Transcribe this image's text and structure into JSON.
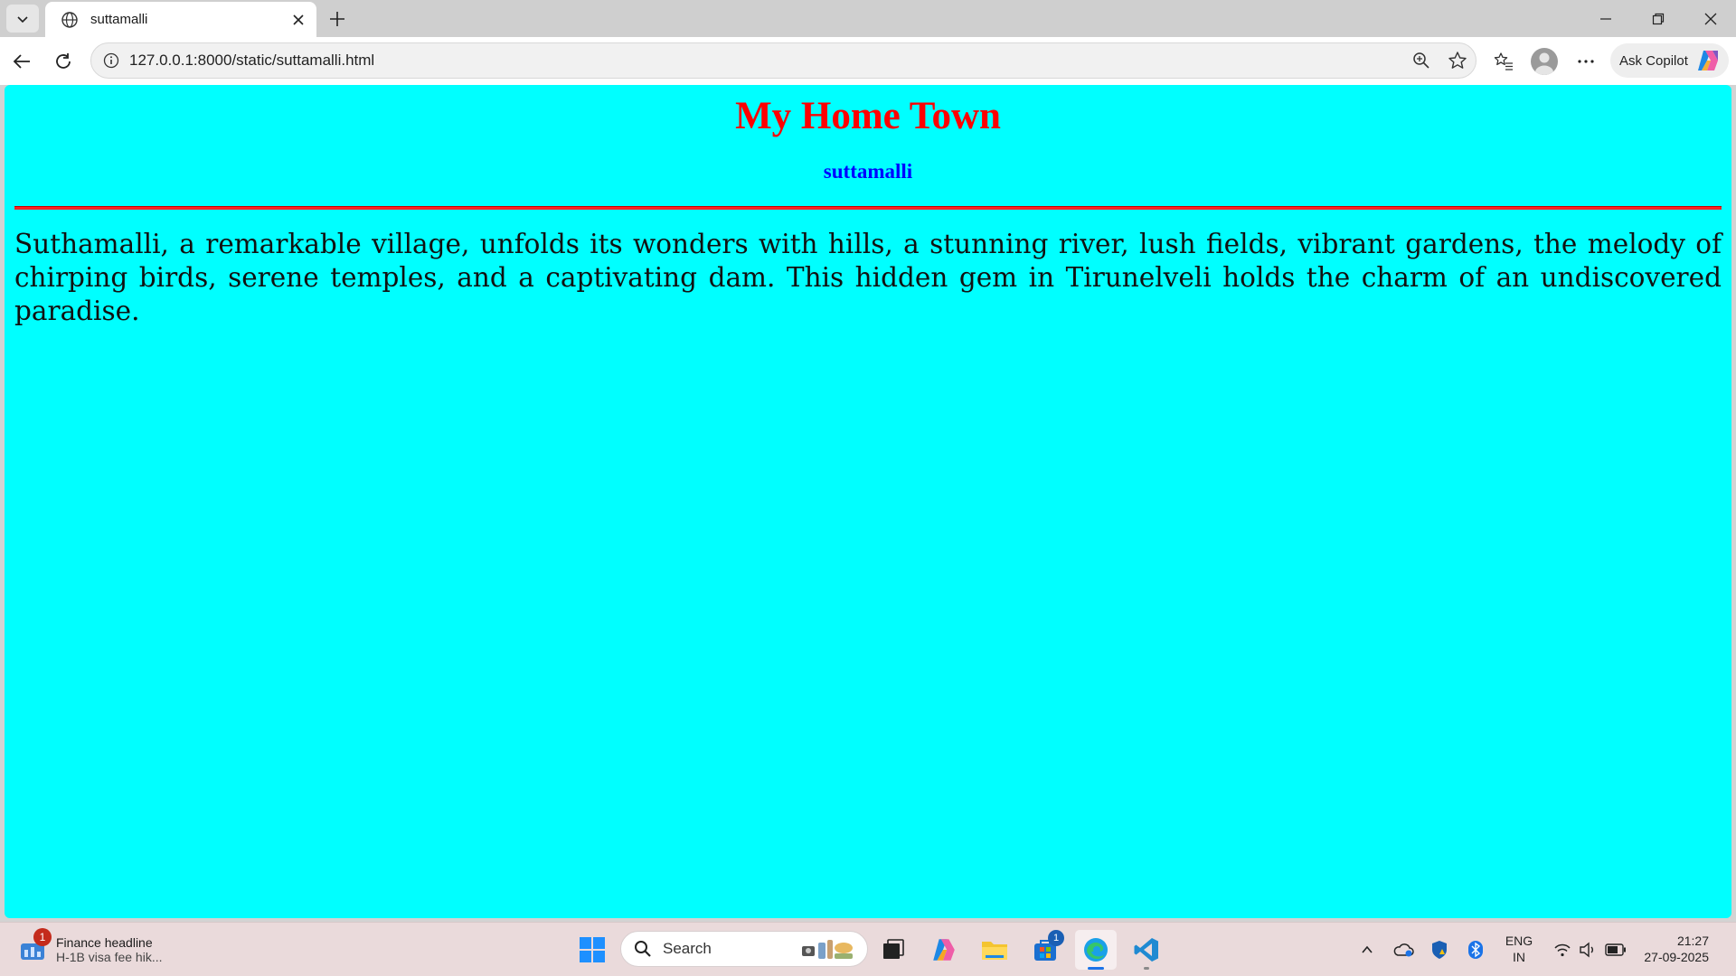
{
  "browser": {
    "tab_title": "suttamalli",
    "url": "127.0.0.1:8000/static/suttamalli.html",
    "copilot_label": "Ask Copilot"
  },
  "page": {
    "heading": "My Home Town",
    "subheading": "suttamalli",
    "paragraph": "Suthamalli, a remarkable village, unfolds its wonders with hills, a stunning river, lush fields, vibrant gardens, the melody of chirping birds, serene temples, and a captivating dam. This hidden gem in Tirunelveli holds the charm of an undiscovered paradise.",
    "background_color": "#00ffff",
    "heading_color": "#ff0000",
    "subheading_color": "#0000ff",
    "rule_color": "#ff2222"
  },
  "taskbar": {
    "widget_badge": "1",
    "widget_title": "Finance headline",
    "widget_subtitle": "H-1B visa fee hik...",
    "search_label": "Search",
    "store_badge": "1",
    "language_line1": "ENG",
    "language_line2": "IN",
    "time": "21:27",
    "date": "27-09-2025"
  }
}
